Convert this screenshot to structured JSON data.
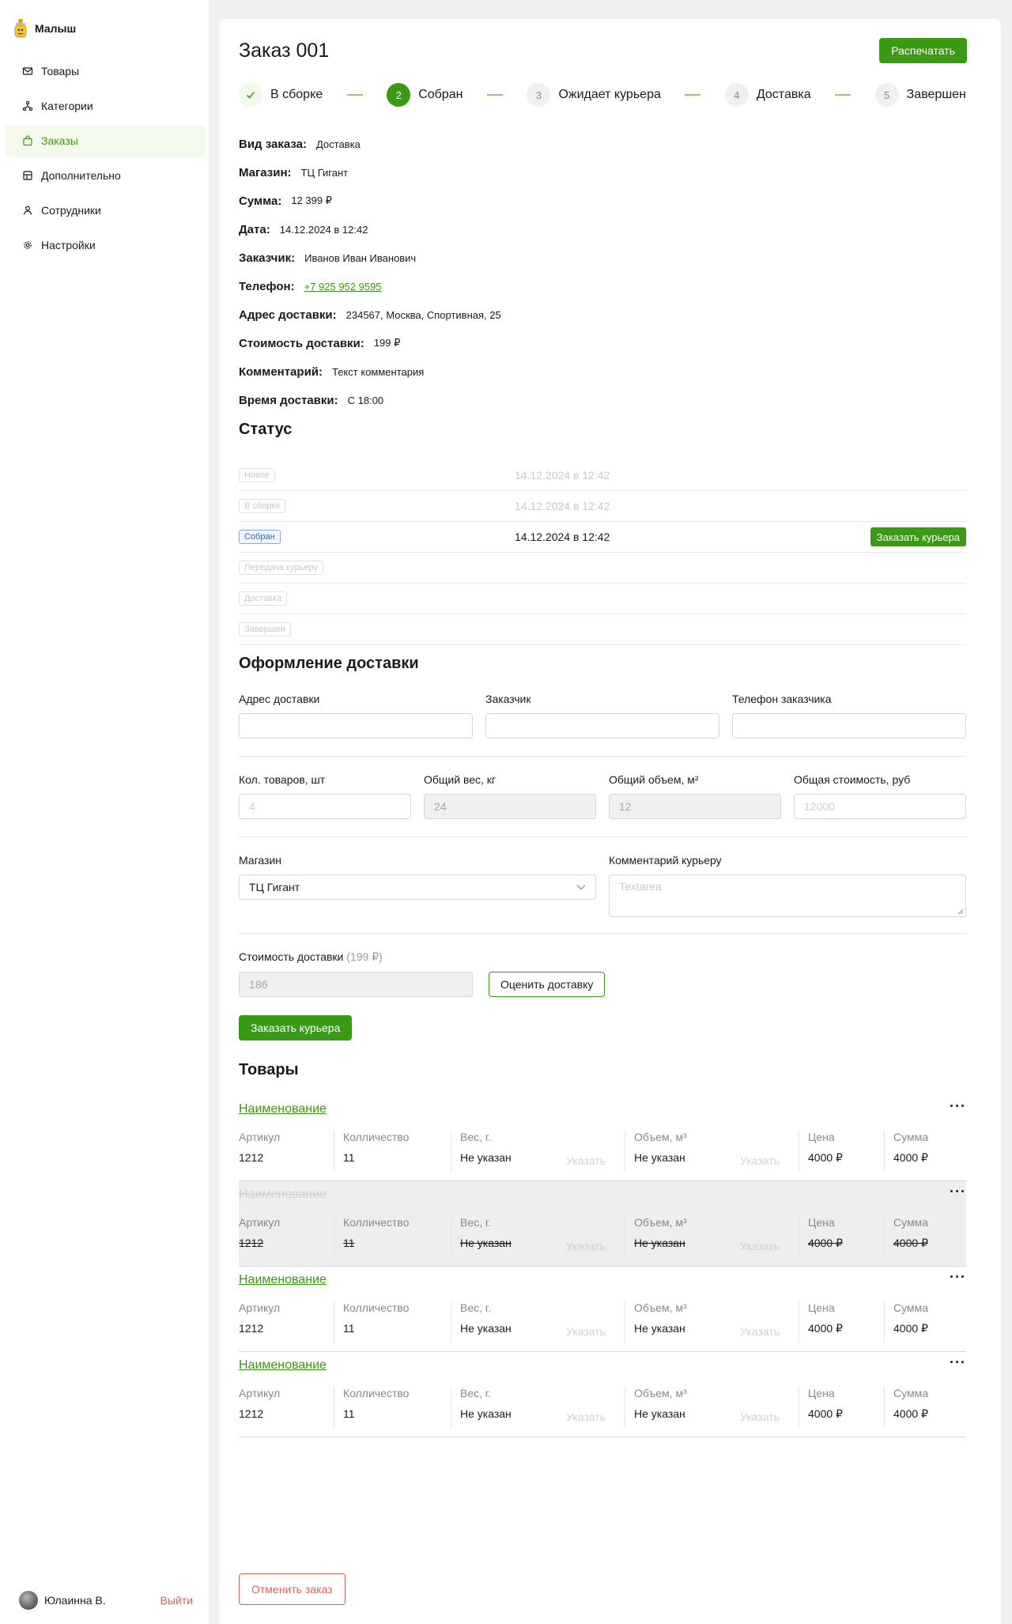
{
  "app": {
    "name": "Малыш"
  },
  "sidebar": {
    "items": [
      {
        "label": "Товары",
        "icon": "mail-icon"
      },
      {
        "label": "Категории",
        "icon": "hierarchy-icon"
      },
      {
        "label": "Заказы",
        "icon": "bag-icon",
        "active": true
      },
      {
        "label": "Дополнительно",
        "icon": "grid-icon"
      },
      {
        "label": "Сотрудники",
        "icon": "user-icon"
      },
      {
        "label": "Настройки",
        "icon": "gear-icon"
      }
    ],
    "user": {
      "name": "Юлаинна В.",
      "logout": "Выйти"
    }
  },
  "order": {
    "title": "Заказ 001",
    "print_label": "Распечатать"
  },
  "stepper": [
    {
      "num": "",
      "label": "В сборке",
      "state": "done"
    },
    {
      "num": "2",
      "label": "Собран",
      "state": "current"
    },
    {
      "num": "3",
      "label": "Ожидает курьера",
      "state": "pending"
    },
    {
      "num": "4",
      "label": "Доставка",
      "state": "pending"
    },
    {
      "num": "5",
      "label": "Завершен",
      "state": "pending"
    }
  ],
  "info": [
    {
      "label": "Вид заказа:",
      "value": "Доставка"
    },
    {
      "label": "Магазин:",
      "value": "ТЦ Гигант"
    },
    {
      "label": "Сумма:",
      "value": "12 399 ₽"
    },
    {
      "label": "Дата:",
      "value": "14.12.2024 в 12:42"
    },
    {
      "label": "Заказчик:",
      "value": "Иванов Иван Иванович"
    },
    {
      "label": "Телефон:",
      "value": "+7 925 952 9595",
      "link": true
    },
    {
      "label": "Адрес доставки:",
      "value": "234567, Москва, Спортивная, 25"
    },
    {
      "label": "Стоимость доставки:",
      "value": "199 ₽"
    },
    {
      "label": "Комментарий:",
      "value": "Текст комментария"
    },
    {
      "label": "Время доставки:",
      "value": "С 18:00"
    }
  ],
  "status": {
    "title": "Статус",
    "rows": [
      {
        "tag": "Новое",
        "date": "14.12.2024 в 12:42"
      },
      {
        "tag": "В сборке",
        "date": "14.12.2024 в 12:42"
      },
      {
        "tag": "Собран",
        "date": "14.12.2024 в 12:42",
        "current": true,
        "action": "Заказать курьера"
      },
      {
        "tag": "Передача курьеру",
        "date": ""
      },
      {
        "tag": "Доставка",
        "date": ""
      },
      {
        "tag": "Завершен",
        "date": ""
      }
    ]
  },
  "delivery": {
    "title": "Оформление доставки",
    "address_label": "Адрес доставки",
    "customer_label": "Заказчик",
    "phone_label": "Телефон заказчика",
    "qty_label": "Кол. товаров, шт",
    "qty_placeholder": "4",
    "weight_label": "Общий вес, кг",
    "weight_value": "24",
    "volume_label": "Общий объем, м²",
    "volume_value": "12",
    "cost_label": "Общая стоимость, руб",
    "cost_placeholder": "12000",
    "store_label": "Магазин",
    "store_value": "ТЦ Гигант",
    "comment_label": "Комментарий курьеру",
    "comment_placeholder": "Textarea",
    "delivery_cost_label": "Стоимость доставки",
    "delivery_cost_hint": "(199 ₽)",
    "delivery_cost_value": "186",
    "estimate_label": "Оценить доставку",
    "order_courier_label": "Заказать курьера"
  },
  "products": {
    "title": "Товары",
    "headers": {
      "sku": "Артикул",
      "qty": "Колличество",
      "weight": "Вес, г.",
      "volume": "Объем, м³",
      "price": "Цена",
      "sum": "Сумма",
      "set_action": "Указать"
    },
    "items": [
      {
        "name": "Наименование",
        "sku": "1212",
        "qty": "11",
        "weight": "Не указан",
        "volume": "Не указан",
        "price": "4000 ₽",
        "sum": "4000 ₽",
        "removed": false
      },
      {
        "name": "Наименование",
        "sku": "1212",
        "qty": "11",
        "weight": "Не указан",
        "volume": "Не указан",
        "price": "4000 ₽",
        "sum": "4000 ₽",
        "removed": true
      },
      {
        "name": "Наименование",
        "sku": "1212",
        "qty": "11",
        "weight": "Не указан",
        "volume": "Не указан",
        "price": "4000 ₽",
        "sum": "4000 ₽",
        "removed": false
      },
      {
        "name": "Наименование",
        "sku": "1212",
        "qty": "11",
        "weight": "Не указан",
        "volume": "Не указан",
        "price": "4000 ₽",
        "sum": "4000 ₽",
        "removed": false
      }
    ]
  },
  "cancel_label": "Отменить заказ",
  "colors": {
    "accent": "#3a9a16",
    "danger": "#e06060",
    "status_current": "#3b64b8"
  }
}
